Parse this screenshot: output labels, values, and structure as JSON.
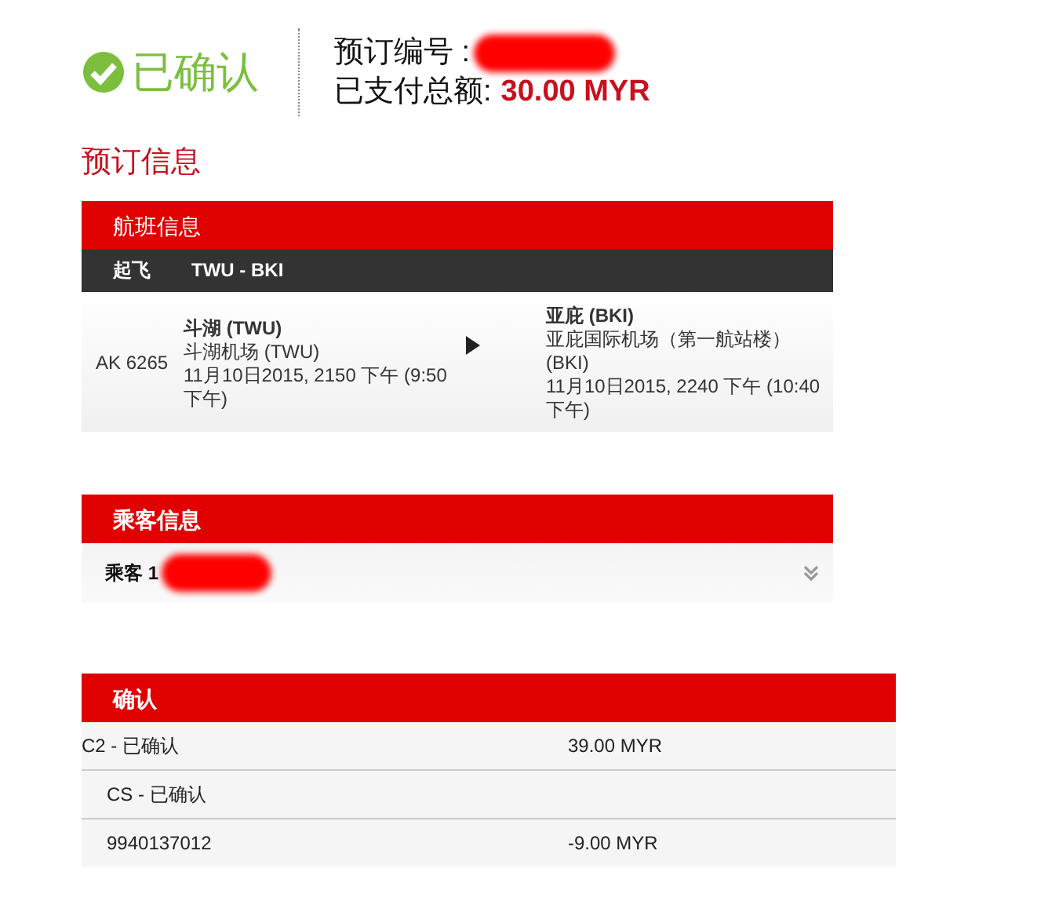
{
  "status": {
    "label": "已确认",
    "confirmed": true
  },
  "summary": {
    "booking_number_label": "预订编号 :",
    "total_label": "已支付总额:",
    "total_value": "30.00 MYR"
  },
  "section_title": "预订信息",
  "flight": {
    "title": "航班信息",
    "direction": "起飞",
    "route": "TWU - BKI",
    "flight_number": "AK 6265",
    "departure": {
      "city": "斗湖 (TWU)",
      "airport": "斗湖机场 (TWU)",
      "time": "11月10日2015, 2150 下午 (9:50 下午)"
    },
    "arrival": {
      "city": "亚庇 (BKI)",
      "airport": "亚庇国际机场（第一航站楼） (BKI)",
      "time": "11月10日2015, 2240 下午 (10:40 下午)"
    }
  },
  "passengers": {
    "title": "乘客信息",
    "items": [
      {
        "label": "乘客 1",
        "expanded": false
      }
    ]
  },
  "confirmation": {
    "title": "确认",
    "rows": [
      {
        "label": "C2 - 已确认",
        "amount": "39.00 MYR",
        "indented": false
      },
      {
        "label": "CS - 已确认",
        "indented": true
      },
      {
        "label": "9940137012",
        "amount": "-9.00 MYR",
        "indented": true
      }
    ]
  }
}
